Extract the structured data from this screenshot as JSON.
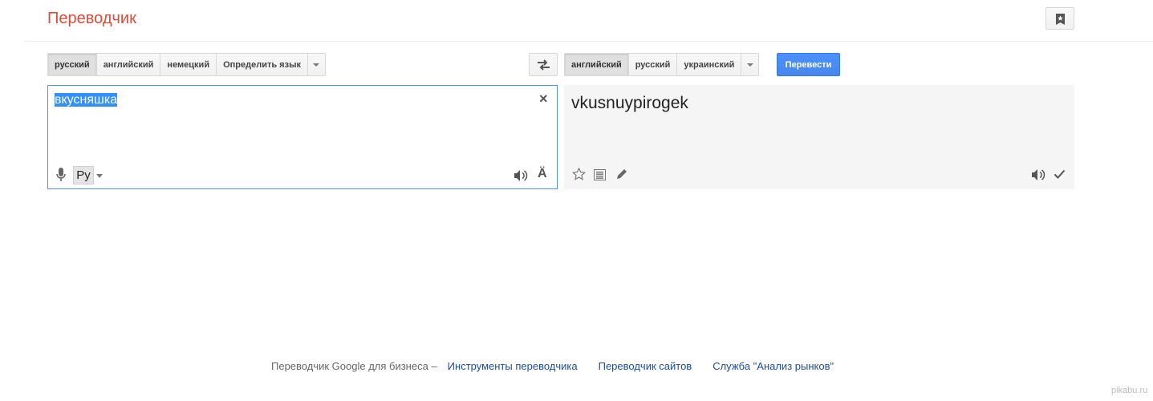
{
  "header": {
    "title": "Переводчик",
    "phrasebook_icon": "phrasebook-star-icon"
  },
  "source": {
    "languages": [
      {
        "label": "русский",
        "selected": true
      },
      {
        "label": "английский",
        "selected": false
      },
      {
        "label": "немецкий",
        "selected": false
      },
      {
        "label": "Определить язык",
        "selected": false
      }
    ],
    "text": "вкусняшка",
    "ime_label": "Ру",
    "a_icon_glyph": "Ä",
    "clear_glyph": "×"
  },
  "swap": {
    "icon": "swap-arrows-icon"
  },
  "target": {
    "languages": [
      {
        "label": "английский",
        "selected": true
      },
      {
        "label": "русский",
        "selected": false
      },
      {
        "label": "украинский",
        "selected": false
      }
    ],
    "translate_label": "Перевести",
    "result_text": "vkusnuypirogek"
  },
  "footer": {
    "prefix": "Переводчик Google для бизнеса –",
    "links": [
      "Инструменты переводчика",
      "Переводчик сайтов",
      "Служба \"Анализ рынков\""
    ]
  },
  "watermark": "pikabu.ru",
  "colors": {
    "title": "#dd4b39",
    "accent": "#4d90fe",
    "link": "#1a4fa0"
  }
}
